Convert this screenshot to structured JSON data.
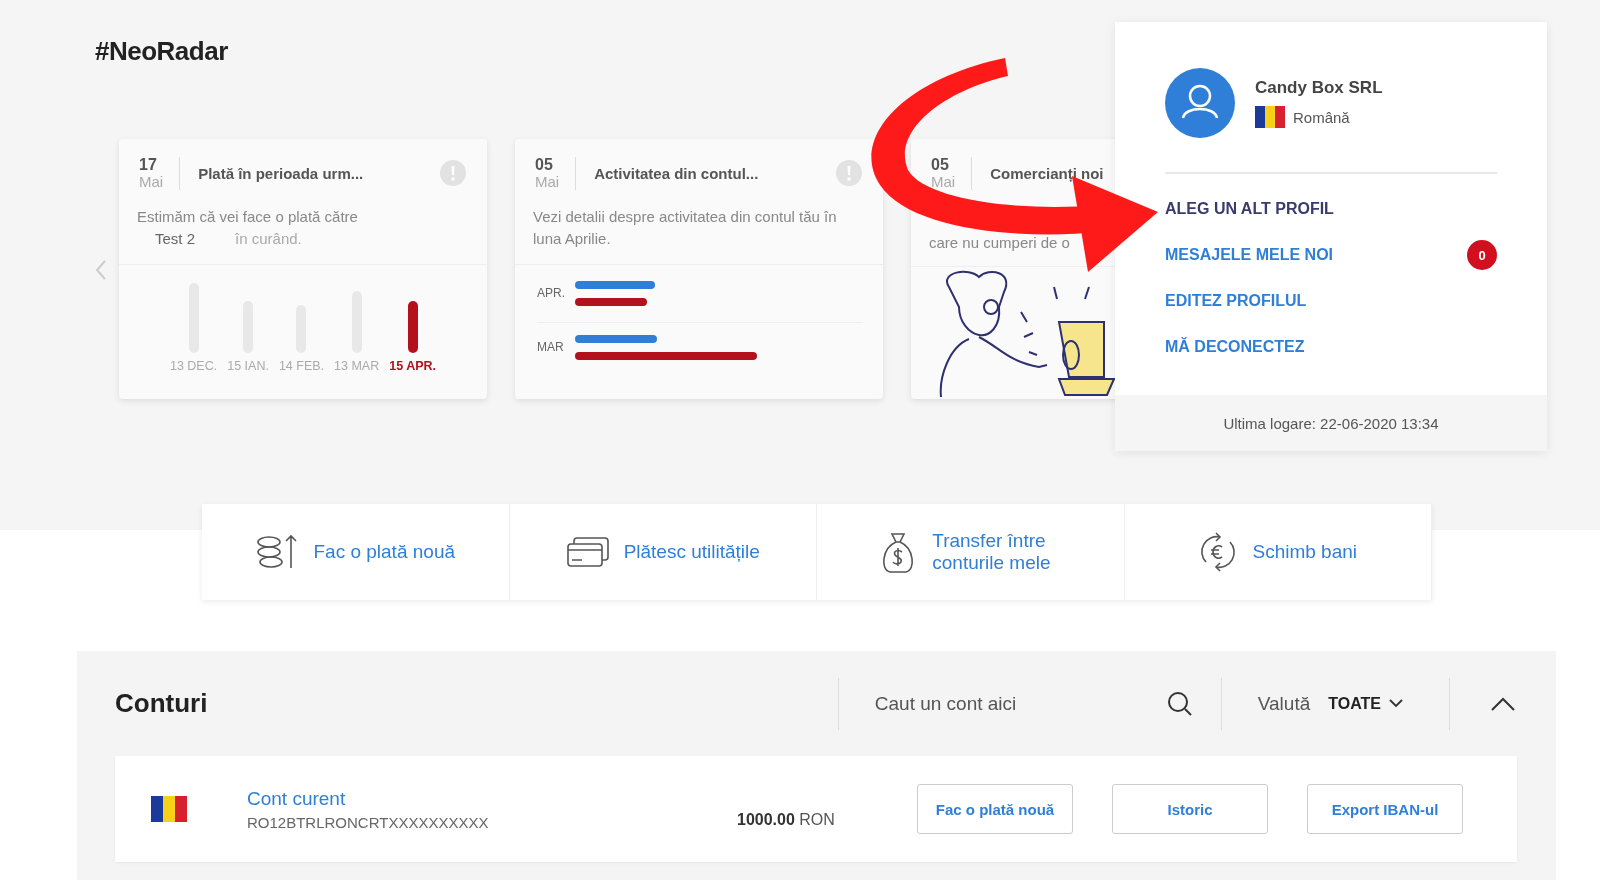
{
  "section_title": "#NeoRadar",
  "cards": [
    {
      "kind": "payment",
      "day": "17",
      "month": "Mai",
      "title": "Plată în perioada urm...",
      "body": "Estimăm că vei face o plată către",
      "payee": "Test 2",
      "body_end": "în curând.",
      "bars": [
        {
          "label": "13 DEC.",
          "selected": false
        },
        {
          "label": "15 IAN.",
          "selected": false
        },
        {
          "label": "14 FEB.",
          "selected": false
        },
        {
          "label": "13 MAR",
          "selected": false
        },
        {
          "label": "15 APR.",
          "selected": true
        }
      ]
    },
    {
      "kind": "activity",
      "day": "05",
      "month": "Mai",
      "title": "Activitatea din contul...",
      "body": "Vezi detalii despre activitatea din contul tău în luna Aprilie.",
      "rows": [
        {
          "label": "APR."
        },
        {
          "label": "MAR"
        }
      ]
    },
    {
      "kind": "illustration",
      "day": "05",
      "month": "Mai",
      "title": "Comercianți noi",
      "body": "care nu cumperi de o"
    }
  ],
  "profile": {
    "name": "Candy Box SRL",
    "language": "Română",
    "menu": [
      {
        "label": "ALEG UN ALT PROFIL",
        "selected": true
      },
      {
        "label": "MESAJELE MELE NOI",
        "selected": false,
        "badge": "0"
      },
      {
        "label": "EDITEZ PROFILUL",
        "selected": false
      },
      {
        "label": "MĂ DECONECTEZ",
        "selected": false
      }
    ],
    "last_login": "Ultima logare: 22-06-2020 13:34"
  },
  "actions": [
    {
      "kind": "payment",
      "label": "Fac o plată nouă"
    },
    {
      "kind": "utilities",
      "label": "Plătesc utilitățile"
    },
    {
      "kind": "transfer",
      "label": "Transfer între conturile mele"
    },
    {
      "kind": "exchange",
      "label": "Schimb bani"
    }
  ],
  "accounts": {
    "title": "Conturi",
    "search": {
      "placeholder": "Caut un cont aici"
    },
    "currency_label": "Valută",
    "currency_value": "TOATE",
    "expanded": true,
    "rows": [
      {
        "name": "Cont curent",
        "iban": "RO12BTRLRONCRTXXXXXXXXXX",
        "amount": "1000.00",
        "currency": "RON",
        "buttons": [
          "Fac o plată nouă",
          "Istoric",
          "Export IBAN-ul"
        ]
      }
    ]
  }
}
